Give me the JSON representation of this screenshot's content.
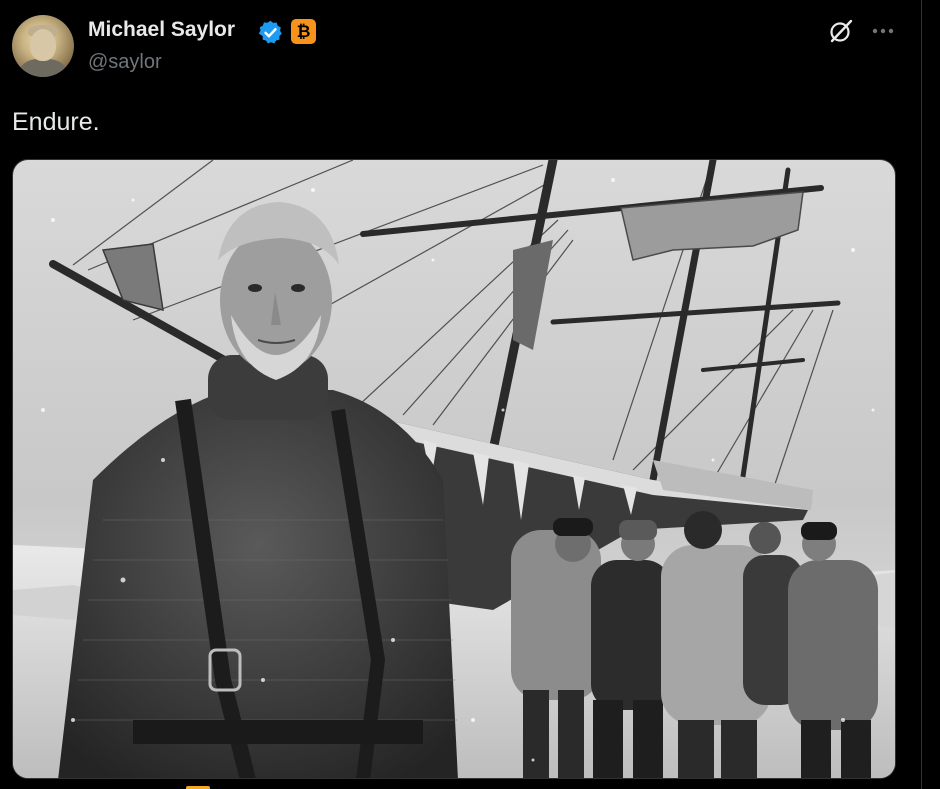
{
  "tweet": {
    "author_name": "Michael Saylor",
    "author_handle": "@saylor",
    "btc_badge": "₿",
    "text": "Endure.",
    "media_alt": "Photo"
  },
  "icons": {
    "verified": "verified-badge-icon",
    "bitcoin": "bitcoin-badge-icon",
    "grok": "grok-icon",
    "more": "more-icon"
  },
  "colors": {
    "background": "#000000",
    "text": "#e7e9ea",
    "secondary_text": "#71767b",
    "verified_blue": "#1d9bf0",
    "bitcoin_orange": "#f7931a"
  }
}
